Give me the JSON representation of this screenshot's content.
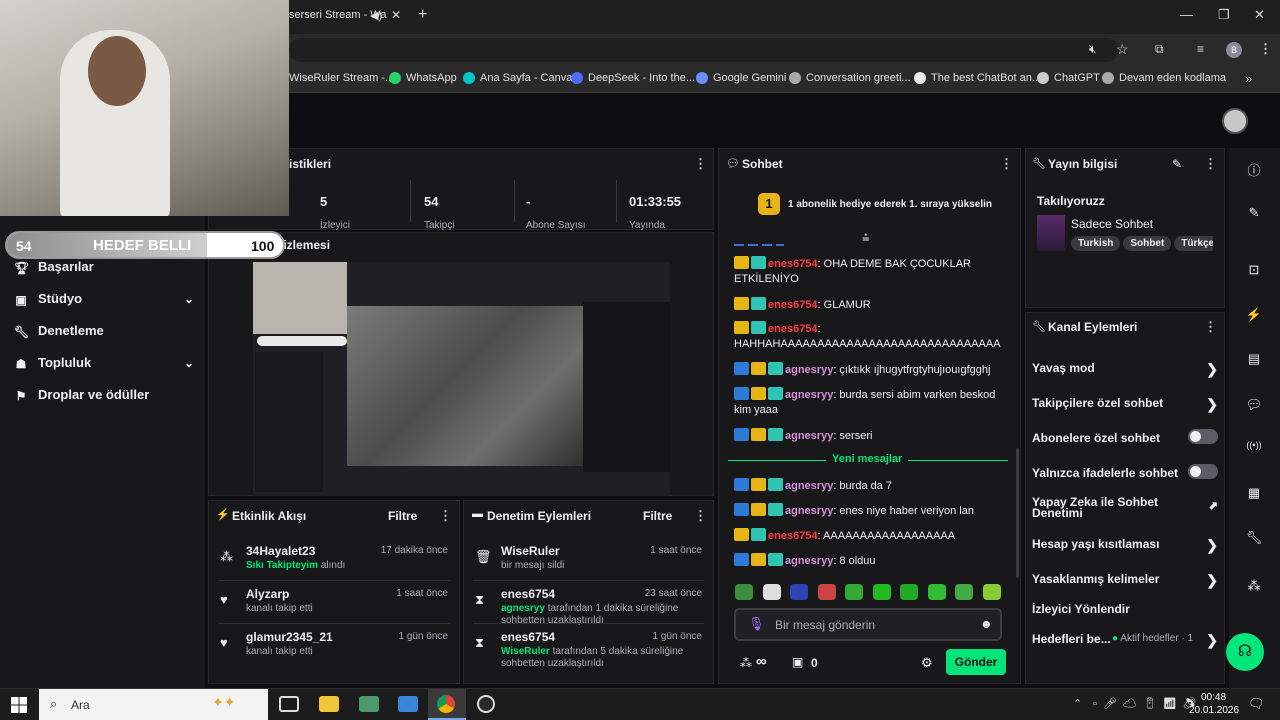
{
  "browser": {
    "tab_title": "serseri Stream - Wa",
    "bookmarks": [
      "WiseRuler Stream -...",
      "WhatsApp",
      "Ana Sayfa - Canva",
      "DeepSeek - Into the...",
      "Google Gemini",
      "Conversation greeti...",
      "The best ChatBot an...",
      "ChatGPT",
      "Devam eden kodlama"
    ],
    "profile_initial": "B"
  },
  "overlay": {
    "goal_current": "54",
    "goal_label": "HEDEF BELLI",
    "goal_target": "100"
  },
  "stats": {
    "title": "istikleri",
    "items": [
      {
        "value": "5",
        "label": "İzleyici"
      },
      {
        "value": "54",
        "label": "Takipçi"
      },
      {
        "value": "-",
        "label": "Abone Sayısı"
      },
      {
        "value": "01:33:55",
        "label": "Yayında"
      }
    ]
  },
  "preview": {
    "title": "Yayın Önizlemesi"
  },
  "nav": {
    "items": [
      {
        "label": "Başarılar",
        "chevron": false
      },
      {
        "label": "Stüdyo",
        "chevron": true
      },
      {
        "label": "Denetleme",
        "chevron": false
      },
      {
        "label": "Topluluk",
        "chevron": true
      },
      {
        "label": "Droplar ve ödüller",
        "chevron": false
      }
    ]
  },
  "activity": {
    "title": "Etkinlik Akışı",
    "filter": "Filtre",
    "events": [
      {
        "name": "34Hayalet23",
        "time": "17 dakika önce",
        "highlight": "Sıkı Takipteyim",
        "desc": " alındı"
      },
      {
        "name": "Alyzarp",
        "time": "1 saat önce",
        "highlight": "",
        "desc": "kanalı takip etti"
      },
      {
        "name": "glamur2345_21",
        "time": "1 gün önce",
        "highlight": "",
        "desc": "kanalı takip etti"
      }
    ]
  },
  "moderation": {
    "title": "Denetim Eylemleri",
    "filter": "Filtre",
    "events": [
      {
        "name": "WiseRuler",
        "time": "1 saat önce",
        "highlight": "",
        "desc": "bir mesajı sildi"
      },
      {
        "name": "enes6754",
        "time": "23 saat önce",
        "highlight": "agnesryy",
        "desc": " tarafından 1 dakika süreliğine sohbetten uzaklaştırıldı"
      },
      {
        "name": "enes6754",
        "time": "1 gün önce",
        "highlight": "WiseRuler",
        "desc": " tarafından 5 dakika süreliğine sohbetten uzaklaştırıldı"
      }
    ]
  },
  "chat": {
    "title": "Sohbet",
    "hype_rank": "1",
    "hype_text": "1 abonelik hediye ederek 1. sıraya yükselin",
    "messages": [
      {
        "user": "enes6754",
        "text": ": OHA DEME BAK ÇOCUKLAR ETKİLENİYO",
        "color": "red"
      },
      {
        "user": "enes6754",
        "text": ": GLAMUR",
        "color": "red"
      },
      {
        "user": "enes6754",
        "text": ": HAHHAHAAAAAAAAAAAAAAAAAAAAAAAAAAAAAA",
        "color": "red"
      },
      {
        "user": "agnesryy",
        "text": ": çıktıkk ıjhugytfrgtyhujıouıgfgghj",
        "color": "pink"
      },
      {
        "user": "agnesryy",
        "text": ": burda sersi abim varken beskod kim yaaa",
        "color": "pink"
      },
      {
        "user": "agnesryy",
        "text": ": serseri",
        "color": "pink"
      }
    ],
    "new_messages_label": "Yeni mesajlar",
    "new_messages": [
      {
        "user": "agnesryy",
        "text": ": burda da 7",
        "color": "pink"
      },
      {
        "user": "agnesryy",
        "text": ": enes niye haber veriyon lan",
        "color": "pink"
      },
      {
        "user": "enes6754",
        "text": ": AAAAAAAAAAAAAAAAAA",
        "color": "red"
      },
      {
        "user": "agnesryy",
        "text": ": 8 olduu",
        "color": "pink"
      }
    ],
    "input_placeholder": "Bir mesaj gönderin",
    "points": "∞",
    "gift_count": "0",
    "send_label": "Gönder"
  },
  "stream_info": {
    "title": "Yayın bilgisi",
    "stream_title": "Takılıyoruzz",
    "category": "Sadece Sohbet",
    "tags": [
      "Turkish",
      "Sohbet",
      "Türkçe"
    ]
  },
  "channel_actions": {
    "title": "Kanal Eylemleri",
    "items": [
      {
        "label": "Yavaş mod",
        "type": "chevron"
      },
      {
        "label": "Takipçilere özel sohbet",
        "type": "chevron"
      },
      {
        "label": "Abonelere özel sohbet",
        "type": "toggle"
      },
      {
        "label": "Yalnızca ifadelerle sohbet",
        "type": "toggle"
      },
      {
        "label": "Yapay Zeka ile Sohbet Denetimi",
        "type": "external"
      },
      {
        "label": "Hesap yaşı kısıtlaması",
        "type": "chevron"
      },
      {
        "label": "Yasaklanmış kelimeler",
        "type": "chevron"
      },
      {
        "label": "İzleyici Yönlendir",
        "type": "none"
      },
      {
        "label": "Hedefleri be...",
        "type": "chevron",
        "extra": "Aktif hedefler · 1"
      }
    ]
  },
  "taskbar": {
    "search_placeholder": "Ara",
    "time": "00:48",
    "date": "20.01.2026"
  },
  "colors": {
    "accent": "#00e67a",
    "panel": "#18181b",
    "page": "#0e0e10",
    "gold": "#e7b416"
  }
}
